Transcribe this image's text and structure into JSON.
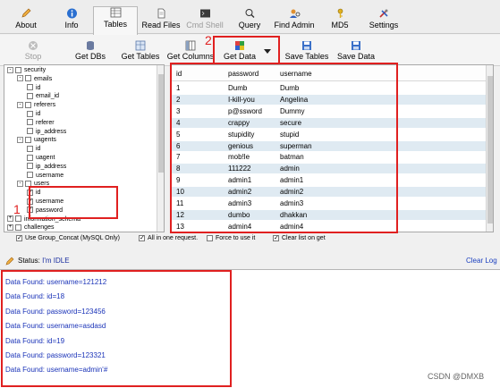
{
  "tabs": [
    {
      "id": "about",
      "label": "About",
      "icon": "pencil-icon"
    },
    {
      "id": "info",
      "label": "Info",
      "icon": "info-icon"
    },
    {
      "id": "tables",
      "label": "Tables",
      "icon": "tables-icon",
      "active": true
    },
    {
      "id": "read-files",
      "label": "Read Files",
      "icon": "file-icon"
    },
    {
      "id": "cmd-shell",
      "label": "Cmd Shell",
      "icon": "terminal-icon",
      "disabled": true
    },
    {
      "id": "query",
      "label": "Query",
      "icon": "query-icon"
    },
    {
      "id": "find-admin",
      "label": "Find Admin",
      "icon": "find-admin-icon"
    },
    {
      "id": "md5",
      "label": "MD5",
      "icon": "key-icon"
    },
    {
      "id": "settings",
      "label": "Settings",
      "icon": "tools-icon"
    }
  ],
  "toolbar": {
    "stop": "Stop",
    "get_dbs": "Get DBs",
    "get_tables": "Get Tables",
    "get_columns": "Get Columns",
    "get_data": "Get Data",
    "save_tables": "Save Tables",
    "save_data": "Save Data"
  },
  "tree": [
    {
      "label": "security",
      "level": 0,
      "expander": "-",
      "checked": false
    },
    {
      "label": "emails",
      "level": 1,
      "expander": "-",
      "checked": false
    },
    {
      "label": "id",
      "level": 2,
      "checked": false
    },
    {
      "label": "email_id",
      "level": 2,
      "checked": false
    },
    {
      "label": "referers",
      "level": 1,
      "expander": "-",
      "checked": false
    },
    {
      "label": "id",
      "level": 2,
      "checked": false
    },
    {
      "label": "referer",
      "level": 2,
      "checked": false
    },
    {
      "label": "ip_address",
      "level": 2,
      "checked": false
    },
    {
      "label": "uagents",
      "level": 1,
      "expander": "-",
      "checked": false
    },
    {
      "label": "id",
      "level": 2,
      "checked": false
    },
    {
      "label": "uagent",
      "level": 2,
      "checked": false
    },
    {
      "label": "ip_address",
      "level": 2,
      "checked": false
    },
    {
      "label": "username",
      "level": 2,
      "checked": false
    },
    {
      "label": "users",
      "level": 1,
      "expander": "-",
      "checked": false
    },
    {
      "label": "id",
      "level": 2,
      "checked": true
    },
    {
      "label": "username",
      "level": 2,
      "checked": true
    },
    {
      "label": "password",
      "level": 2,
      "checked": true
    },
    {
      "label": "information_schema",
      "level": 0,
      "expander": "+",
      "checked": false
    },
    {
      "label": "challenges",
      "level": 0,
      "expander": "+",
      "checked": false
    }
  ],
  "grid": {
    "columns": [
      "id",
      "password",
      "username"
    ],
    "rows": [
      [
        "1",
        "Dumb",
        "Dumb"
      ],
      [
        "2",
        "I-kill-you",
        "Angelina"
      ],
      [
        "3",
        "p@ssword",
        "Dummy"
      ],
      [
        "4",
        "crappy",
        "secure"
      ],
      [
        "5",
        "stupidity",
        "stupid"
      ],
      [
        "6",
        "genious",
        "superman"
      ],
      [
        "7",
        "mob!le",
        "batman"
      ],
      [
        "8",
        "111222",
        "admin"
      ],
      [
        "9",
        "admin1",
        "admin1"
      ],
      [
        "10",
        "admin2",
        "admin2"
      ],
      [
        "11",
        "admin3",
        "admin3"
      ],
      [
        "12",
        "dumbo",
        "dhakkan"
      ],
      [
        "13",
        "admin4",
        "admin4"
      ]
    ]
  },
  "options": [
    {
      "label": "Use Group_Concat (MySQL Only)",
      "checked": true
    },
    {
      "label": "All in one request.",
      "checked": true
    },
    {
      "label": "Force to use it",
      "checked": false
    },
    {
      "label": "Clear list on get",
      "checked": true
    }
  ],
  "status": {
    "label": "Status:",
    "value": "I'm IDLE",
    "clear_log": "Clear Log"
  },
  "log": [
    "Data Found: username=121212",
    "Data Found: id=18",
    "Data Found: password=123456",
    "Data Found: username=asdasd",
    "Data Found: id=19",
    "Data Found: password=123321",
    "Data Found: username=admin'#"
  ],
  "annotations": {
    "one": "1",
    "two": "2"
  },
  "watermark": "CSDN @DMXВ",
  "colors": {
    "annotation_red": "#e02020",
    "log_text": "#1a33b8",
    "row_alt": "#dfeaf2"
  }
}
